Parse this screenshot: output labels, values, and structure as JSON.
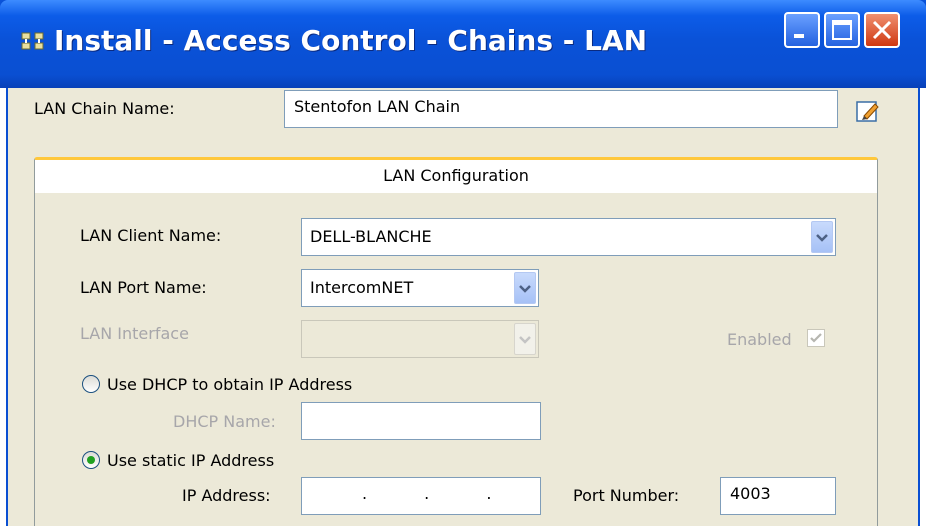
{
  "window": {
    "title": "Install - Access Control - Chains - LAN",
    "icon": "network-icon",
    "controls": [
      "minimize-icon",
      "maximize-icon",
      "close-icon"
    ]
  },
  "chain_name": {
    "label": "LAN Chain Name:",
    "value": "Stentofon LAN Chain",
    "edit_icon": "pencil-icon"
  },
  "panel": {
    "title": "LAN Configuration"
  },
  "client": {
    "label": "LAN Client Name:",
    "selected": "DELL-BLANCHE"
  },
  "port": {
    "label": "LAN Port Name:",
    "selected": "IntercomNET"
  },
  "interface": {
    "label": "LAN Interface",
    "selected": "",
    "enabled_label": "Enabled",
    "enabled_checked": true
  },
  "dhcp": {
    "radio_label": "Use DHCP to obtain IP Address",
    "selected": false,
    "name_label": "DHCP Name:",
    "name_value": ""
  },
  "static_ip": {
    "radio_label": "Use static IP Address",
    "selected": true,
    "ip_label": "IP Address:",
    "ip_value": ".  .  .",
    "port_label": "Port Number:",
    "port_value": "4003"
  },
  "colors": {
    "title_bar": "#0a52d8",
    "dialog_bg": "#ece9d8",
    "tab_accent": "#ffc83c",
    "radio_dot": "#21a121"
  }
}
